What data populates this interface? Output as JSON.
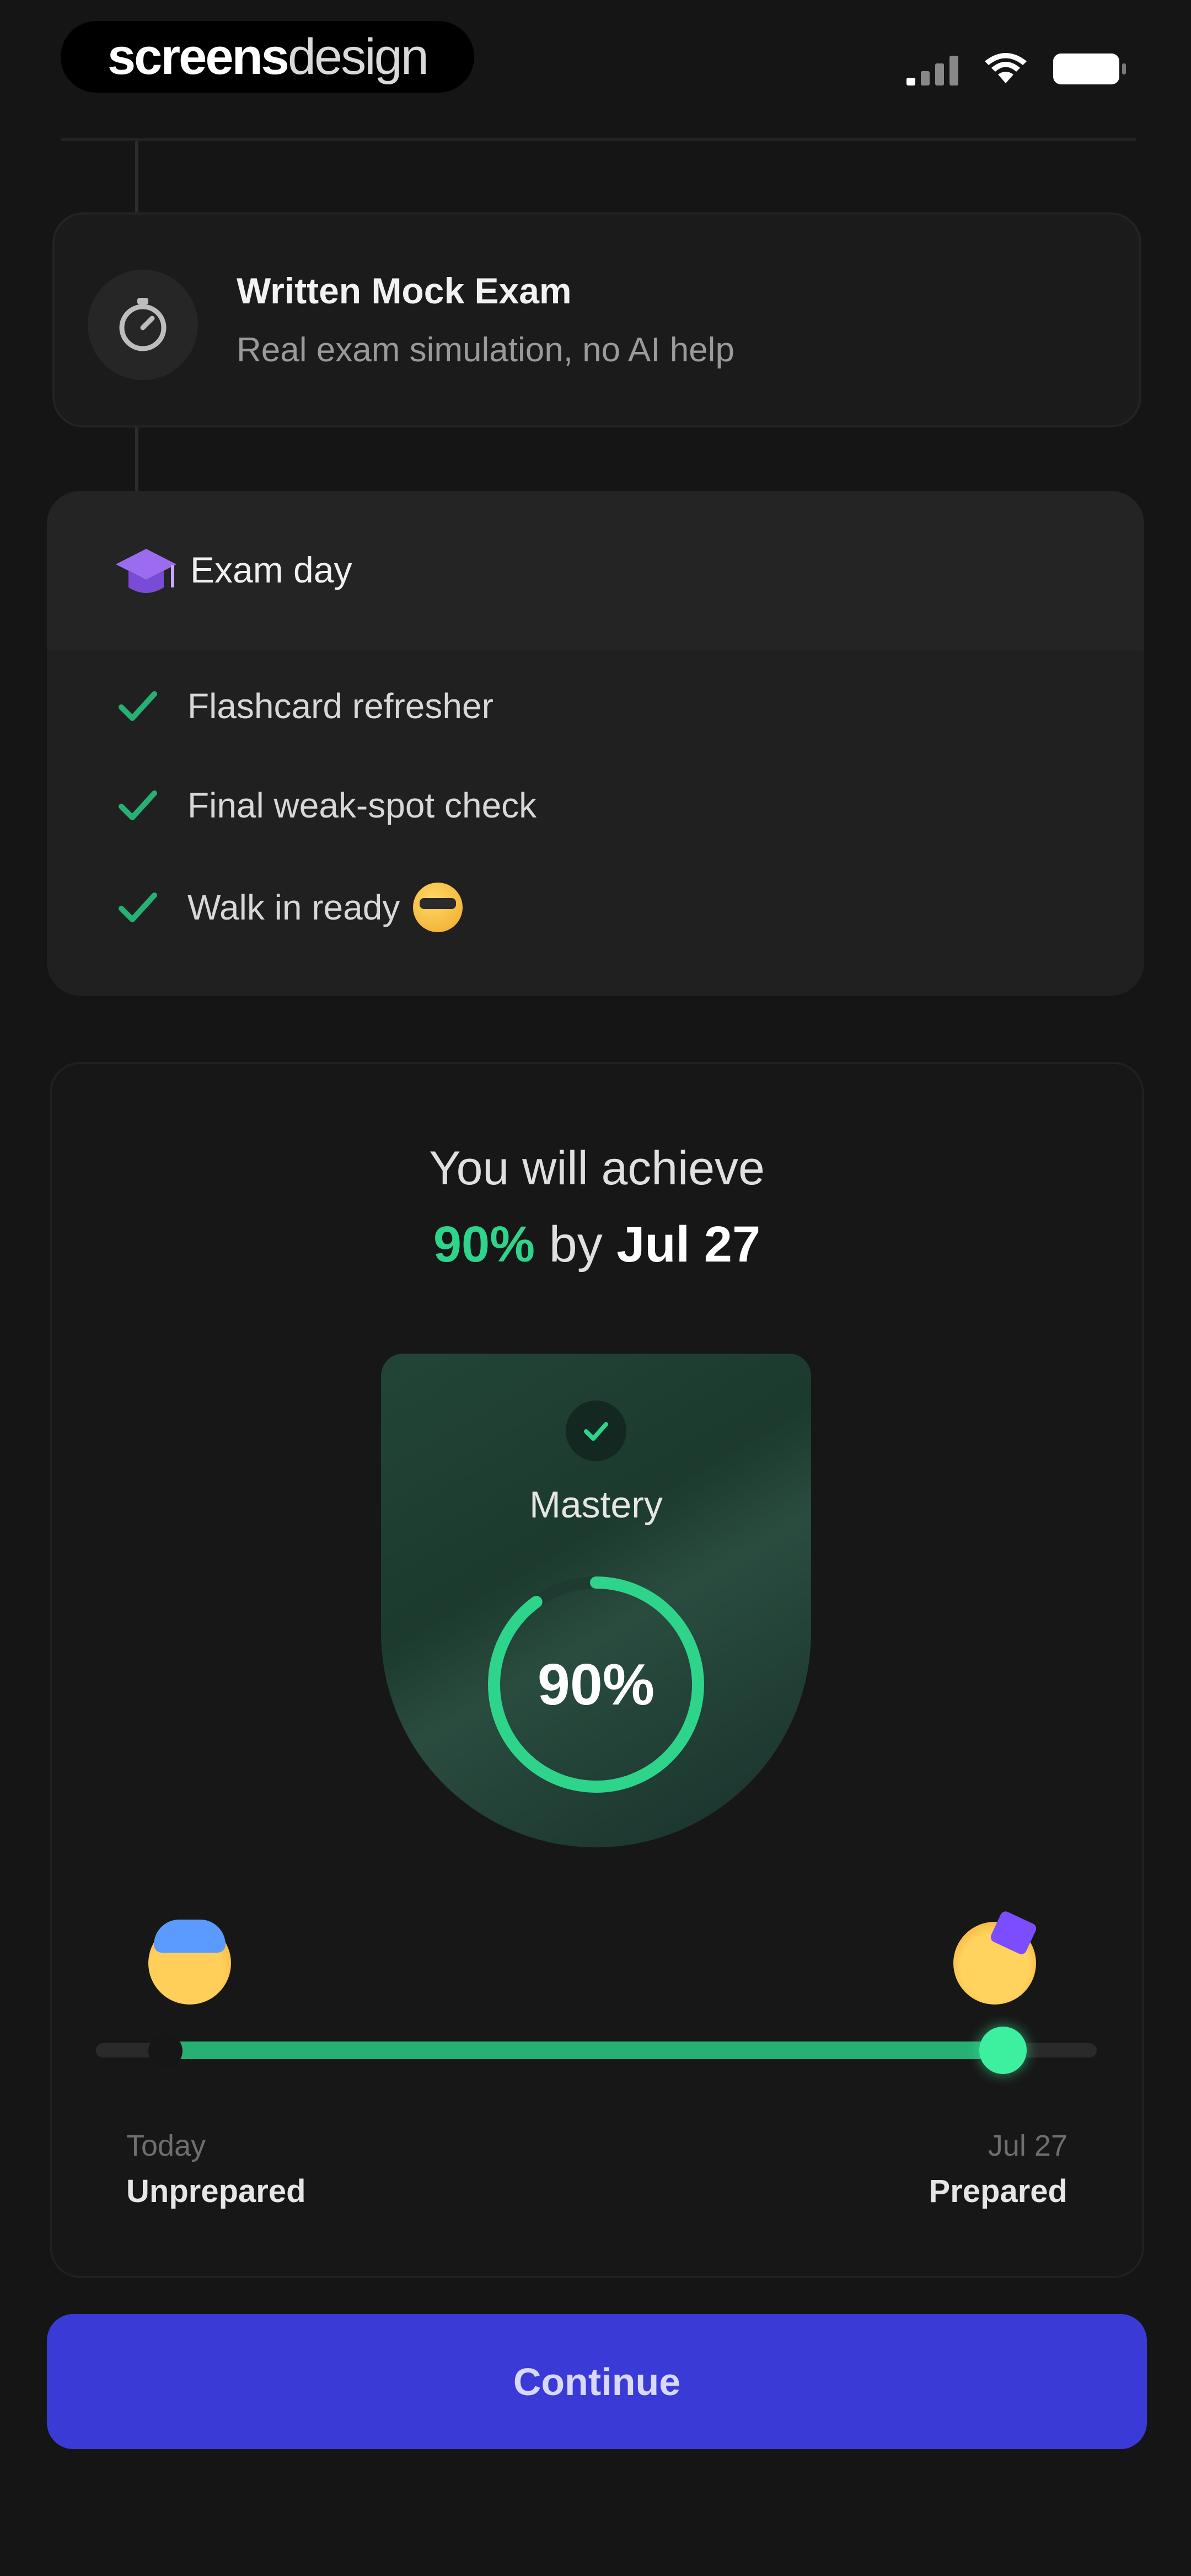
{
  "status_bar": {
    "logo_bold": "screens",
    "logo_light": "design",
    "signal_icon": "signal-bars-icon",
    "wifi_icon": "wifi-icon",
    "battery_icon": "battery-icon"
  },
  "mock_exam": {
    "icon": "stopwatch-icon",
    "title": "Written Mock Exam",
    "subtitle": "Real exam simulation, no AI help"
  },
  "exam_day": {
    "icon": "graduation-cap-icon",
    "title": "Exam day",
    "tasks": [
      {
        "label": "Flashcard refresher"
      },
      {
        "label": "Final weak-spot check"
      },
      {
        "label": "Walk in ready"
      }
    ]
  },
  "result": {
    "headline_line1": "You will achieve",
    "headline_pct": "90%",
    "headline_by": "by",
    "headline_date": "Jul 27",
    "badge_label": "Mastery",
    "ring_value": "90%",
    "ring_fraction": 0.9,
    "progress_fraction": 0.9,
    "start_date": "Today",
    "start_state": "Unprepared",
    "end_date": "Jul 27",
    "end_state": "Prepared",
    "colors": {
      "accent": "#2fd48b",
      "button": "#3a3ad6"
    }
  },
  "cta": {
    "continue_label": "Continue"
  }
}
